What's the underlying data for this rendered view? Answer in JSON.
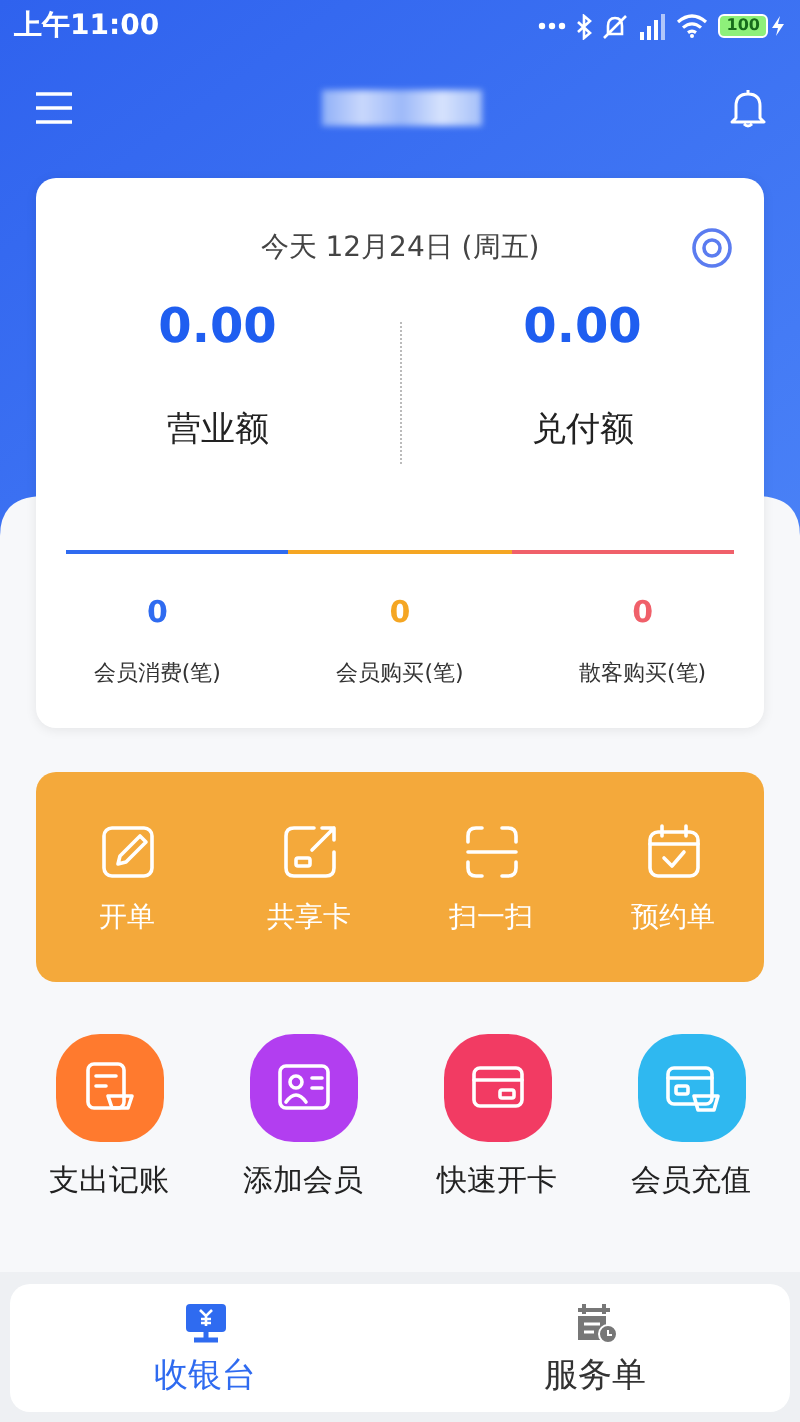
{
  "status_bar": {
    "time": "上午11:00",
    "battery": "100"
  },
  "summary": {
    "date": "今天 12月24日 (周五)",
    "totals": [
      {
        "value": "0.00",
        "label": "营业额"
      },
      {
        "value": "0.00",
        "label": "兑付额"
      }
    ],
    "counts": [
      {
        "value": "0",
        "label": "会员消费(笔)",
        "color": "#2f6bf0"
      },
      {
        "value": "0",
        "label": "会员购买(笔)",
        "color": "#f5a623"
      },
      {
        "value": "0",
        "label": "散客购买(笔)",
        "color": "#f0606a"
      }
    ]
  },
  "quick_actions": [
    {
      "label": "开单",
      "kind": "edit"
    },
    {
      "label": "共享卡",
      "kind": "share"
    },
    {
      "label": "扫一扫",
      "kind": "scan"
    },
    {
      "label": "预约单",
      "kind": "calendar"
    }
  ],
  "features": [
    {
      "label": "支出记账",
      "kind": "ledger",
      "color": "#ff7a2e"
    },
    {
      "label": "添加会员",
      "kind": "member",
      "color": "#b23ef0"
    },
    {
      "label": "快速开卡",
      "kind": "card",
      "color": "#f23b63"
    },
    {
      "label": "会员充值",
      "kind": "recharge",
      "color": "#2fb8f0"
    }
  ],
  "tabs": [
    {
      "label": "收银台",
      "kind": "cashier",
      "selected": true
    },
    {
      "label": "服务单",
      "kind": "orders",
      "selected": false
    }
  ]
}
